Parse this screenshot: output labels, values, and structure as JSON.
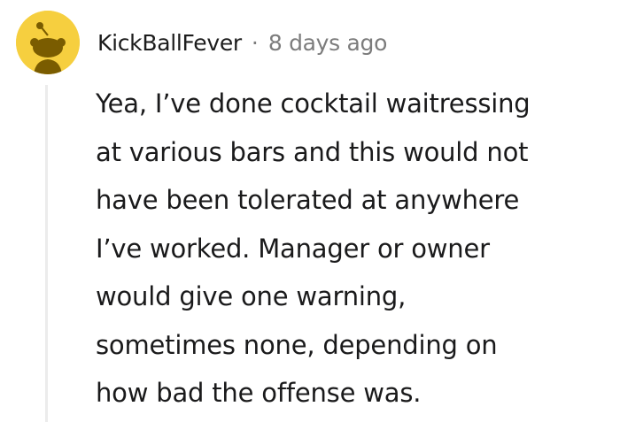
{
  "comment": {
    "author": "KickBallFever",
    "separator": "·",
    "timestamp": "8 days ago",
    "avatar_icon": "snoo-avatar-icon",
    "avatar_color": "#f6cf3f",
    "body_lines": [
      "Yea, I’ve done cocktail waitressing",
      "at various bars and this would not",
      "have been tolerated at anywhere",
      "I’ve worked. Manager or owner",
      "would give one warning,",
      "sometimes none, depending on",
      "how bad the offense was."
    ]
  }
}
